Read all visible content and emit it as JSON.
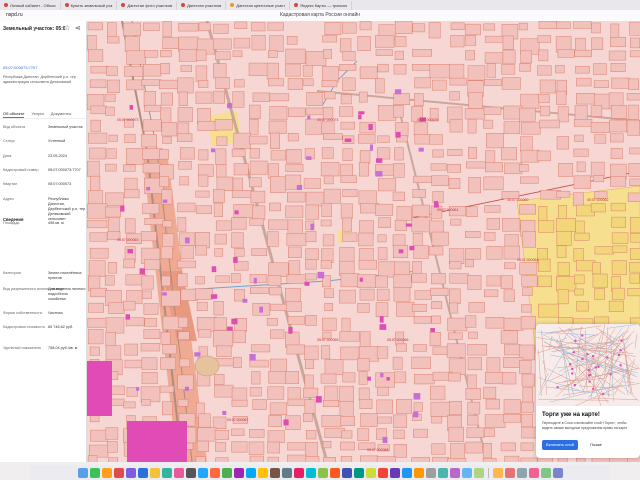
{
  "browser": {
    "tabs": [
      {
        "label": "Личный кабинет - Объяс",
        "color": "#d9463b"
      },
      {
        "label": "Купить земельный уча",
        "color": "#d9463b"
      },
      {
        "label": "Дагестан фото участков",
        "color": "#d9463b"
      },
      {
        "label": "Дагестан участков",
        "color": "#d9463b"
      },
      {
        "label": "Дагестан цветочные участ",
        "color": "#e0a21b"
      },
      {
        "label": "Яндекс Карты — транспо",
        "color": "#d9463b"
      }
    ],
    "url": "nspd.ru",
    "page_title": "Кадастровая карта России онлайн"
  },
  "panel": {
    "header": "Земельный участок: 05:07:000073:7707",
    "subtitle": "05:07:000073:7707",
    "address": "Республика Дагестан, Дербентский р-н, тер администрация сельсовета Деликовский",
    "tabs": [
      "Об объекте",
      "Услуги",
      "Документы"
    ],
    "rows": [
      {
        "k": "Вид объекта",
        "v": "Земельный участок"
      },
      {
        "k": "Статус",
        "v": "Учтенный"
      },
      {
        "k": "Дата",
        "v": "23.05.2024"
      },
      {
        "k": "Кадастровый номер",
        "v": "05:07:000073:7707"
      },
      {
        "k": "Квартал",
        "v": "05:07:000073"
      },
      {
        "k": "Адрес",
        "v": "Республика Дагестан, Дербентский р-н, тер Деликовский сельсовет"
      },
      {
        "k": "Площадь",
        "v": "498 кв. м"
      },
      {
        "k": "Категория",
        "v": "Земли населённых пунктов"
      },
      {
        "k": "Вид разрешенного использования",
        "v": "Для ведения личного подсобного хозяйства"
      },
      {
        "k": "Форма собственности",
        "v": "Частная"
      },
      {
        "k": "Кадастровая стоимость",
        "v": "65 746,62 руб."
      },
      {
        "k": "Удельный показатель",
        "v": "758,04 руб./кв. м"
      }
    ],
    "section_label": "Сведения"
  },
  "map_labels": [
    "05:07:000073",
    "05:07:000074",
    "05:07:000075",
    "05:07:000060",
    "05:07:000061",
    "05:07:000062",
    "05:07:000063",
    "05:07:000064",
    "05:07:000065",
    "05:07:000066",
    "05:07:000067",
    "05:07:000068"
  ],
  "promo": {
    "title": "Торги уже на карте!",
    "text": "Переходите в Слои и включайте слой «Торги», чтобы видеть самые выгодные предложения прямо на карте",
    "primary": "Включить слой",
    "secondary": "Позже"
  },
  "colors": {
    "parcel_fill": "#f6cfcb",
    "parcel_border": "#d9816f",
    "magenta": "#e04bb5",
    "yellow_zone": "#f6e08f",
    "road": "#c2a39a",
    "accent": "#2b6fe0"
  }
}
